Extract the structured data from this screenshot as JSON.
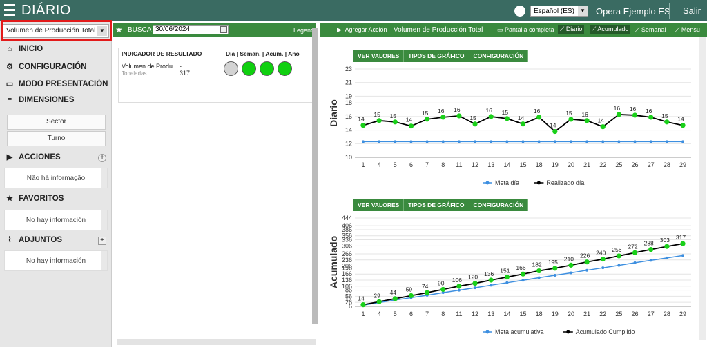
{
  "header": {
    "title": "DIÁRIO",
    "language": "Español (ES)",
    "user": "Opera Ejemplo ES",
    "logout": "Salir"
  },
  "sidebar": {
    "indicator_select": "Volumen de Producción Total",
    "menu": {
      "inicio": "INICIO",
      "configuracion": "CONFIGURACIÓN",
      "modo_presentacion": "MODO PRESENTACIÓN",
      "dimensiones": "DIMENSIONES"
    },
    "dimension_buttons": [
      "Sector",
      "Turno"
    ],
    "acciones": {
      "label": "ACCIONES",
      "empty": "Não há informação"
    },
    "favoritos": {
      "label": "FAVORITOS",
      "empty": "No hay información"
    },
    "adjuntos": {
      "label": "ADJUNTOS",
      "empty": "No hay información"
    }
  },
  "middle": {
    "busca_label": "BUSCA",
    "date": "30/06/2024",
    "legend_label": "Legend",
    "table": {
      "header_indicator": "INDICADOR DE RESULTADO",
      "header_periods": "Dia | Seman. | Acum. | Ano",
      "row": {
        "name": "Volumen de Produ...",
        "unit": "Toneladas",
        "meta": "-",
        "value": "317",
        "status_colors": [
          "#d3d3d3",
          "#10d010",
          "#10d010",
          "#10d010"
        ]
      }
    }
  },
  "toolbar": {
    "add_action": "Agregar Acción",
    "title": "Volumen de Producción Total",
    "fullscreen": "Pantalla completa",
    "daily": "Diario",
    "accumulated": "Acumulado",
    "weekly": "Semanal",
    "monthly": "Mensu"
  },
  "chart_tabs": {
    "values": "VER VALORES",
    "types": "TIPOS DE GRÁFICO",
    "config": "CONFIGURACIÓN"
  },
  "chart_data": [
    {
      "type": "line",
      "ylabel": "Diario",
      "ylim": [
        10,
        23
      ],
      "yticks": [
        10,
        12,
        14,
        16,
        18,
        19,
        21,
        23
      ],
      "categories": [
        "1",
        "4",
        "5",
        "6",
        "7",
        "8",
        "11",
        "12",
        "13",
        "14",
        "15",
        "18",
        "19",
        "20",
        "21",
        "22",
        "25",
        "26",
        "27",
        "28",
        "29"
      ],
      "series": [
        {
          "name": "Meta día",
          "color": "#3d8fe0",
          "values": [
            12.3,
            12.3,
            12.3,
            12.3,
            12.3,
            12.3,
            12.3,
            12.3,
            12.3,
            12.3,
            12.3,
            12.3,
            12.3,
            12.3,
            12.3,
            12.3,
            12.3,
            12.3,
            12.3,
            12.3,
            12.3
          ]
        },
        {
          "name": "Realizado día",
          "color": "#000000",
          "values": [
            14.7,
            15.4,
            15.2,
            14.6,
            15.6,
            15.9,
            16.1,
            14.9,
            16.0,
            15.7,
            14.9,
            15.9,
            13.8,
            15.6,
            15.4,
            14.5,
            16.3,
            16.2,
            15.9,
            15.2,
            14.7
          ],
          "labels": [
            "14",
            "15",
            "15",
            "14",
            "15",
            "16",
            "16",
            "15",
            "16",
            "15",
            "14",
            "16",
            "14",
            "15",
            "16",
            "14",
            "16",
            "16",
            "16",
            "15",
            "14"
          ]
        }
      ],
      "legend": "bottom"
    },
    {
      "type": "line",
      "ylabel": "Acumulado",
      "ylim": [
        6,
        444
      ],
      "yticks": [
        6,
        26,
        56,
        86,
        106,
        136,
        166,
        196,
        206,
        236,
        266,
        306,
        336,
        356,
        386,
        406,
        444
      ],
      "categories": [
        "1",
        "4",
        "5",
        "6",
        "7",
        "8",
        "11",
        "12",
        "13",
        "14",
        "15",
        "18",
        "19",
        "20",
        "21",
        "22",
        "25",
        "26",
        "27",
        "28",
        "29"
      ],
      "series": [
        {
          "name": "Meta acumulativa",
          "color": "#3d8fe0",
          "values": [
            12,
            25,
            37,
            49,
            61,
            74,
            86,
            98,
            111,
            123,
            135,
            148,
            160,
            172,
            185,
            197,
            209,
            222,
            234,
            246,
            258
          ]
        },
        {
          "name": "Acumulado Cumplido",
          "color": "#000000",
          "values": [
            14,
            29,
            44,
            59,
            74,
            90,
            106,
            120,
            136,
            151,
            166,
            182,
            195,
            210,
            226,
            240,
            256,
            272,
            288,
            303,
            317
          ],
          "labels": [
            "14",
            "29",
            "44",
            "59",
            "74",
            "90",
            "106",
            "120",
            "136",
            "151",
            "166",
            "182",
            "195",
            "210",
            "226",
            "240",
            "256",
            "272",
            "288",
            "303",
            "317"
          ]
        }
      ],
      "legend": "bottom"
    }
  ]
}
